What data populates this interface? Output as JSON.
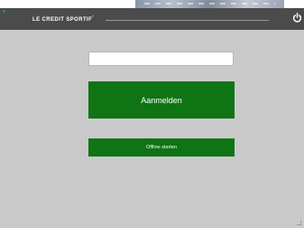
{
  "app": {
    "brand": "LE CREDIT SPORTIF",
    "brand_mark": "°"
  },
  "login": {
    "code_value": "",
    "code_placeholder": "",
    "login_label": "Aanmelden",
    "offline_label": "Offline starten"
  },
  "icons": {
    "power": "power-icon"
  },
  "colors": {
    "title_bar": "#4b4b4b",
    "background": "#c9c9c9",
    "button_green": "#0e7414",
    "button_text": "#ffffff"
  }
}
